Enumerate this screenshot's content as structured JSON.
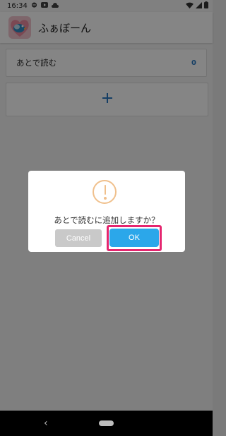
{
  "statusbar": {
    "time": "16:34"
  },
  "appbar": {
    "title": "ふぁぼーん"
  },
  "list": {
    "label": "あとで読む",
    "count": "0"
  },
  "add_card": {
    "icon": "plus-icon"
  },
  "dialog": {
    "icon": "exclamation-icon",
    "message": "あとで読むに追加しますか？",
    "cancel_label": "Cancel",
    "ok_label": "OK"
  },
  "colors": {
    "accent": "#2ba7ea",
    "warning": "#f0c08c",
    "highlight_border": "#e5266f",
    "count": "#2b79c2"
  }
}
